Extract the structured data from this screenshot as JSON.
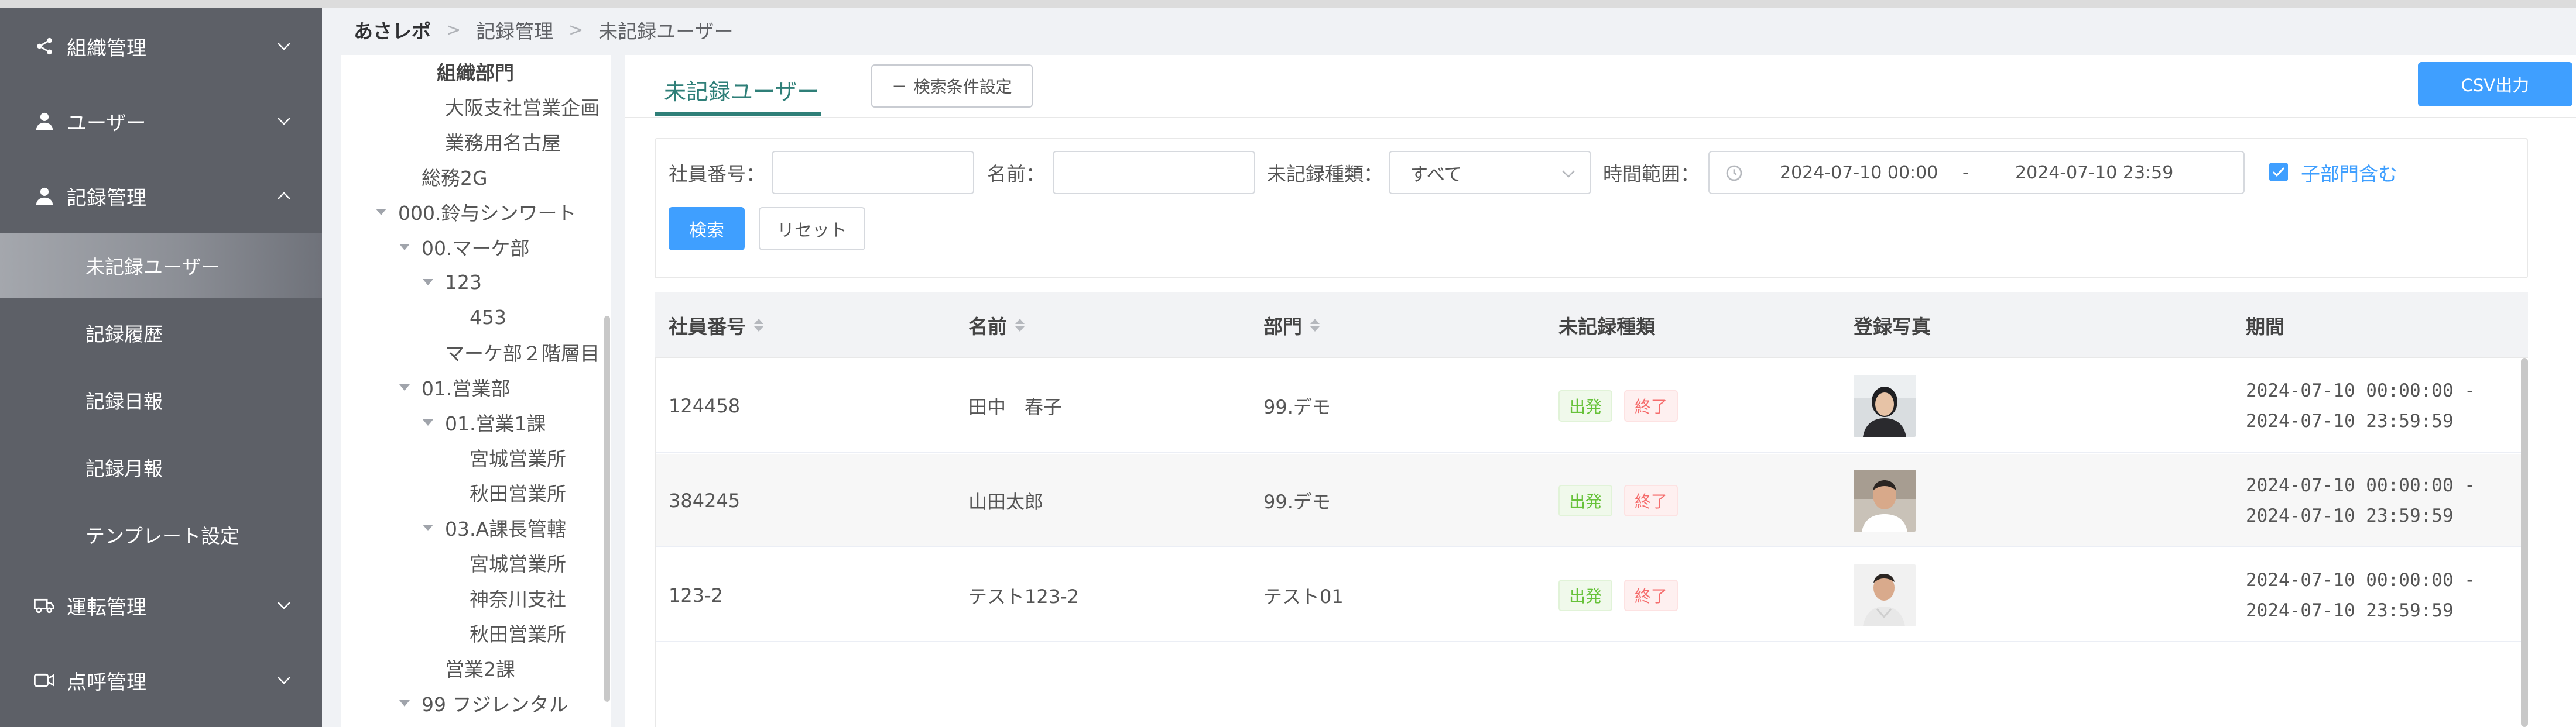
{
  "sidebar": {
    "items": [
      {
        "label": "組織管理",
        "icon": "share-icon"
      },
      {
        "label": "ユーザー",
        "icon": "user-icon"
      },
      {
        "label": "記録管理",
        "icon": "user-icon"
      },
      {
        "label": "運転管理",
        "icon": "truck-icon"
      },
      {
        "label": "点呼管理",
        "icon": "video-icon"
      }
    ],
    "sub_items": [
      {
        "label": "未記録ユーザー",
        "active": true
      },
      {
        "label": "記録履歴"
      },
      {
        "label": "記録日報"
      },
      {
        "label": "記録月報"
      },
      {
        "label": "テンプレート設定"
      }
    ]
  },
  "breadcrumb": [
    "あさレポ",
    "記録管理",
    "未記録ユーザー"
  ],
  "tree": [
    "組織部門",
    "大阪支社営業企画",
    "業務用名古屋",
    "総務2G",
    "000.鈴与シンワート",
    "00.マーケ部",
    "123",
    "453",
    "マーケ部２階層目",
    "01.営業部",
    "01.営業1課",
    "宮城営業所",
    "秋田営業所",
    "03.A課長管轄",
    "宮城営業所",
    "神奈川支社",
    "秋田営業所",
    "営業2課",
    "99 フジレンタル"
  ],
  "tab": {
    "label": "未記録ユーザー"
  },
  "filter_toggle_label": "検索条件設定",
  "csv_label": "CSV出力",
  "search": {
    "employee_no_label": "社員番号：",
    "employee_no_value": "",
    "name_label": "名前：",
    "name_value": "",
    "type_label": "未記録種類：",
    "type_value": "すべて",
    "time_label": "時間範囲：",
    "date_start": "2024-07-10 00:00",
    "date_sep": "-",
    "date_end": "2024-07-10 23:59",
    "include_sub_label": "子部門含む",
    "include_sub_checked": true,
    "search_btn": "検索",
    "reset_btn": "リセット"
  },
  "table": {
    "headers": [
      "社員番号",
      "名前",
      "部門",
      "未記録種類",
      "登録写真",
      "期間"
    ],
    "rows": [
      {
        "id": "124458",
        "name": "田中　春子",
        "dept": "99.デモ",
        "tags": [
          "出発",
          "終了"
        ],
        "period_start": "2024-07-10 00:00:00 -",
        "period_end": "2024-07-10 23:59:59"
      },
      {
        "id": "384245",
        "name": "山田太郎",
        "dept": "99.デモ",
        "tags": [
          "出発",
          "終了"
        ],
        "period_start": "2024-07-10 00:00:00 -",
        "period_end": "2024-07-10 23:59:59"
      },
      {
        "id": "123-2",
        "name": "テスト123-2",
        "dept": "テスト01",
        "tags": [
          "出発",
          "終了"
        ],
        "period_start": "2024-07-10 00:00:00 -",
        "period_end": "2024-07-10 23:59:59"
      }
    ]
  },
  "colors": {
    "sidebar_bg": "#5d6067",
    "accent": "#3f9fff",
    "tab_accent": "#2f7f78",
    "tag_green": "#67c23a",
    "tag_red": "#f56c6c"
  }
}
